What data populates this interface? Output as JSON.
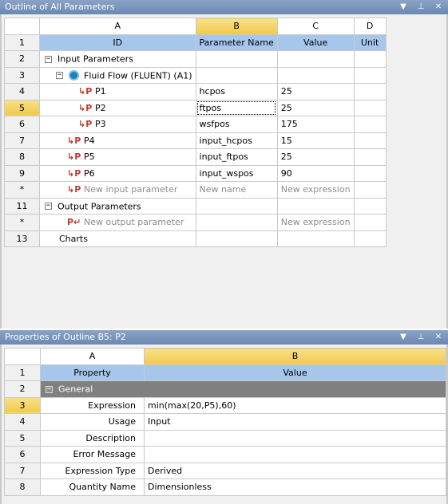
{
  "outline": {
    "title": "Outline of All Parameters",
    "columns": [
      "A",
      "B",
      "C",
      "D"
    ],
    "header": {
      "row": "1",
      "id": "ID",
      "name": "Parameter Name",
      "value": "Value",
      "unit": "Unit"
    },
    "rows": {
      "r2": {
        "num": "2",
        "label": "Input Parameters"
      },
      "r3": {
        "num": "3",
        "label": "Fluid Flow (FLUENT) (A1)"
      },
      "r4": {
        "num": "4",
        "id": "P1",
        "name": "hcpos",
        "value": "25"
      },
      "r5": {
        "num": "5",
        "id": "P2",
        "name": "ftpos",
        "value": "25"
      },
      "r6": {
        "num": "6",
        "id": "P3",
        "name": "wsfpos",
        "value": "175"
      },
      "r7": {
        "num": "7",
        "id": "P4",
        "name": "input_hcpos",
        "value": "15"
      },
      "r8": {
        "num": "8",
        "id": "P5",
        "name": "input_ftpos",
        "value": "25"
      },
      "r9": {
        "num": "9",
        "id": "P6",
        "name": "input_wspos",
        "value": "90"
      },
      "rNewIn": {
        "num": "*",
        "id": "New input parameter",
        "name": "New name",
        "value": "New expression"
      },
      "r11": {
        "num": "11",
        "label": "Output Parameters"
      },
      "rNewOut": {
        "num": "*",
        "id": "New output parameter",
        "value": "New expression"
      },
      "r13": {
        "num": "13",
        "label": "Charts"
      }
    }
  },
  "properties": {
    "title": "Properties of Outline B5: P2",
    "columns": [
      "A",
      "B"
    ],
    "header": {
      "row": "1",
      "property": "Property",
      "value": "Value"
    },
    "group": {
      "row": "2",
      "label": "General"
    },
    "rows": [
      {
        "num": "3",
        "property": "Expression",
        "value": "min(max(20,P5),60)"
      },
      {
        "num": "4",
        "property": "Usage",
        "value": "Input"
      },
      {
        "num": "5",
        "property": "Description",
        "value": ""
      },
      {
        "num": "6",
        "property": "Error Message",
        "value": ""
      },
      {
        "num": "7",
        "property": "Expression Type",
        "value": "Derived"
      },
      {
        "num": "8",
        "property": "Quantity Name",
        "value": "Dimensionless"
      }
    ]
  },
  "icons": {
    "dropdown": "chevron-down-icon",
    "pin": "pin-icon",
    "close": "close-icon",
    "param": "parameter-icon",
    "system": "fluent-system-icon"
  },
  "colors": {
    "titlebar": "#7590b9",
    "header_row": "#a7c6ec",
    "selected": "#f1c94a",
    "group_row": "#808080",
    "param_icon": "#c0392b"
  }
}
